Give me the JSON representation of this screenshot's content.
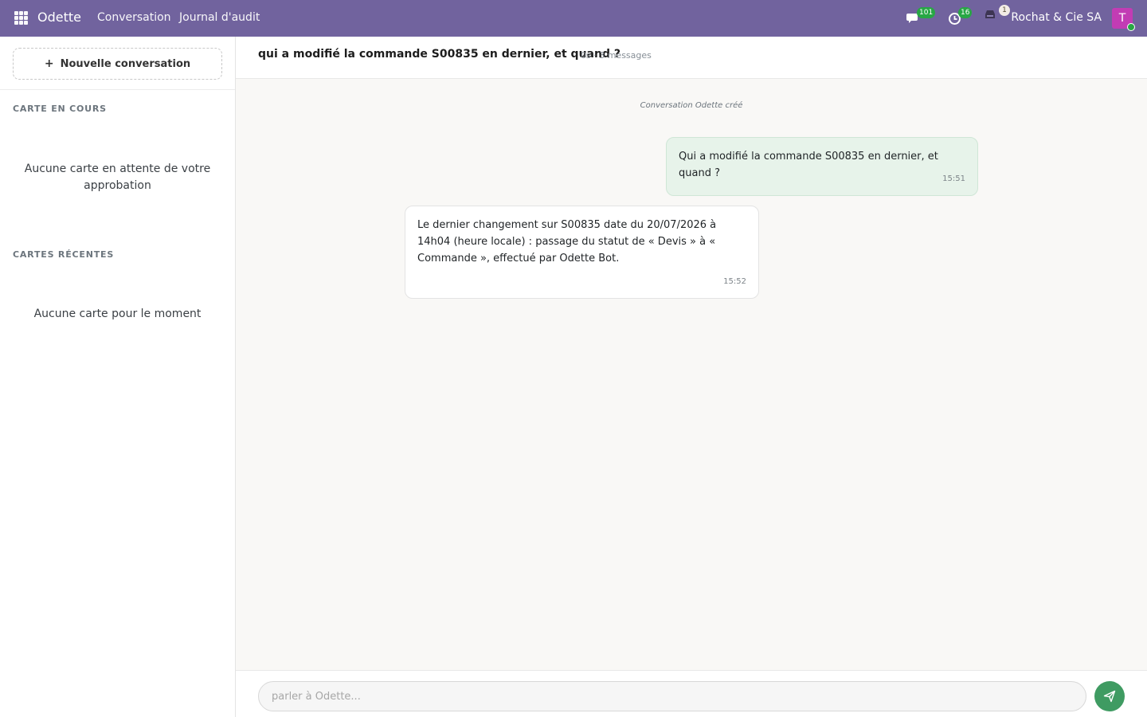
{
  "navbar": {
    "brand": "Odette",
    "menu": [
      "Conversation",
      "Journal d'audit"
    ],
    "messages_count": "101",
    "activities_count": "16",
    "notifications_count": "1",
    "company": "Rochat & Cie SA",
    "avatar_initial": "T",
    "colors": {
      "bar": "#71639e",
      "avatar": "#c23cb4",
      "badge": "#28a745"
    }
  },
  "sidebar": {
    "new_conversation_label": "Nouvelle conversation",
    "section_current_title": "CARTE EN COURS",
    "section_current_empty": "Aucune carte en attente de votre approbation",
    "section_recent_title": "CARTES RÉCENTES",
    "section_recent_empty": "Aucune carte pour le moment"
  },
  "chat": {
    "title": "qui a modifié la commande S00835 en dernier, et quand ?",
    "meta": "0s · 3 messages",
    "system_note": "Conversation Odette créé",
    "messages": [
      {
        "role": "user",
        "text": "Qui a modifié la commande S00835 en dernier, et quand ?",
        "time": "15:51"
      },
      {
        "role": "assistant",
        "text": "Le dernier changement sur S00835 date du 20/07/2026 à 14h04 (heure locale) : passage du statut de « Devis » à « Commande », effectué par Odette Bot.",
        "time": "15:52"
      }
    ]
  },
  "composer": {
    "placeholder": "parler à Odette...",
    "value": "",
    "send_color": "#3f9b62"
  }
}
